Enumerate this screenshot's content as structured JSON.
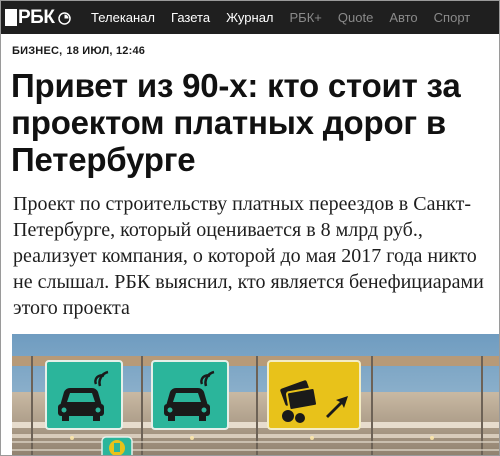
{
  "header": {
    "logo_text": "РБК",
    "nav": [
      {
        "label": "Телеканал",
        "state": "active"
      },
      {
        "label": "Газета",
        "state": "active"
      },
      {
        "label": "Журнал",
        "state": "active"
      },
      {
        "label": "РБК+",
        "state": "dim"
      },
      {
        "label": "Quote",
        "state": "dim"
      },
      {
        "label": "Авто",
        "state": "dim"
      },
      {
        "label": "Спорт",
        "state": "dim"
      }
    ]
  },
  "article": {
    "rubric": "БИЗНЕС,",
    "datetime": "18 ИЮЛ, 12:46",
    "headline": "Привет из 90-х: кто стоит за проектом платных дорог в Петербурге",
    "lead": "Проект по строительству платных переездов в Санкт-Петербурге, который оценивается в 8 млрд руб., реализует компания, о которой до мая 2017 года никто не слышал. РБК выяснил, кто является бенефициарами этого проекта"
  },
  "colors": {
    "topbar": "#1f1f1f",
    "sign_green": "#2bb59b",
    "sign_yellow": "#e8c21a",
    "sky": "#7fa9c8"
  },
  "icons": [
    "globe-icon",
    "car-icon",
    "wifi-icon",
    "payment-cards-icon",
    "arrow-icon"
  ]
}
